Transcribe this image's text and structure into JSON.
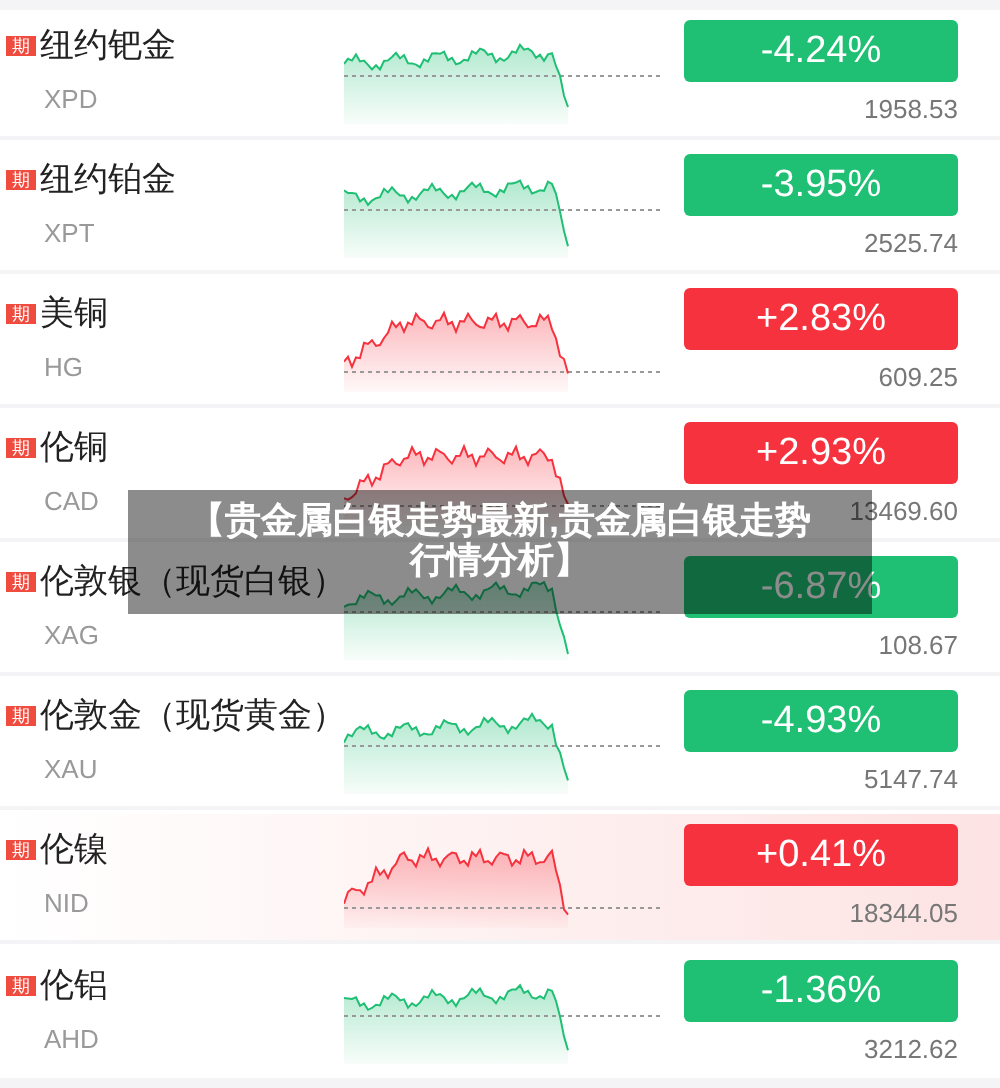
{
  "rows": [
    {
      "badge": "期",
      "name": "纽约钯金",
      "code": "XPD",
      "change": "-4.24%",
      "price": "1958.53",
      "color": "#1fbf74",
      "highlighted": false
    },
    {
      "badge": "期",
      "name": "纽约铂金",
      "code": "XPT",
      "change": "-3.95%",
      "price": "2525.74",
      "color": "#1fbf74",
      "highlighted": false
    },
    {
      "badge": "期",
      "name": "美铜",
      "code": "HG",
      "change": "+2.83%",
      "price": "609.25",
      "color": "#f6323e",
      "highlighted": false
    },
    {
      "badge": "期",
      "name": "伦铜",
      "code": "CAD",
      "change": "+2.93%",
      "price": "13469.60",
      "color": "#f6323e",
      "highlighted": false
    },
    {
      "badge": "期",
      "name": "伦敦银（现货白银）",
      "code": "XAG",
      "change": "-6.87%",
      "price": "108.67",
      "color": "#1fbf74",
      "highlighted": false
    },
    {
      "badge": "期",
      "name": "伦敦金（现货黄金）",
      "code": "XAU",
      "change": "-4.93%",
      "price": "5147.74",
      "color": "#1fbf74",
      "highlighted": false
    },
    {
      "badge": "期",
      "name": "伦镍",
      "code": "NID",
      "change": "+0.41%",
      "price": "18344.05",
      "color": "#f6323e",
      "highlighted": true
    },
    {
      "badge": "期",
      "name": "伦铝",
      "code": "AHD",
      "change": "-1.36%",
      "price": "3212.62",
      "color": "#1fbf74",
      "highlighted": false
    }
  ],
  "banner": {
    "text": "【贵金属白银走势最新,贵金属白银走势行情分析】"
  }
}
